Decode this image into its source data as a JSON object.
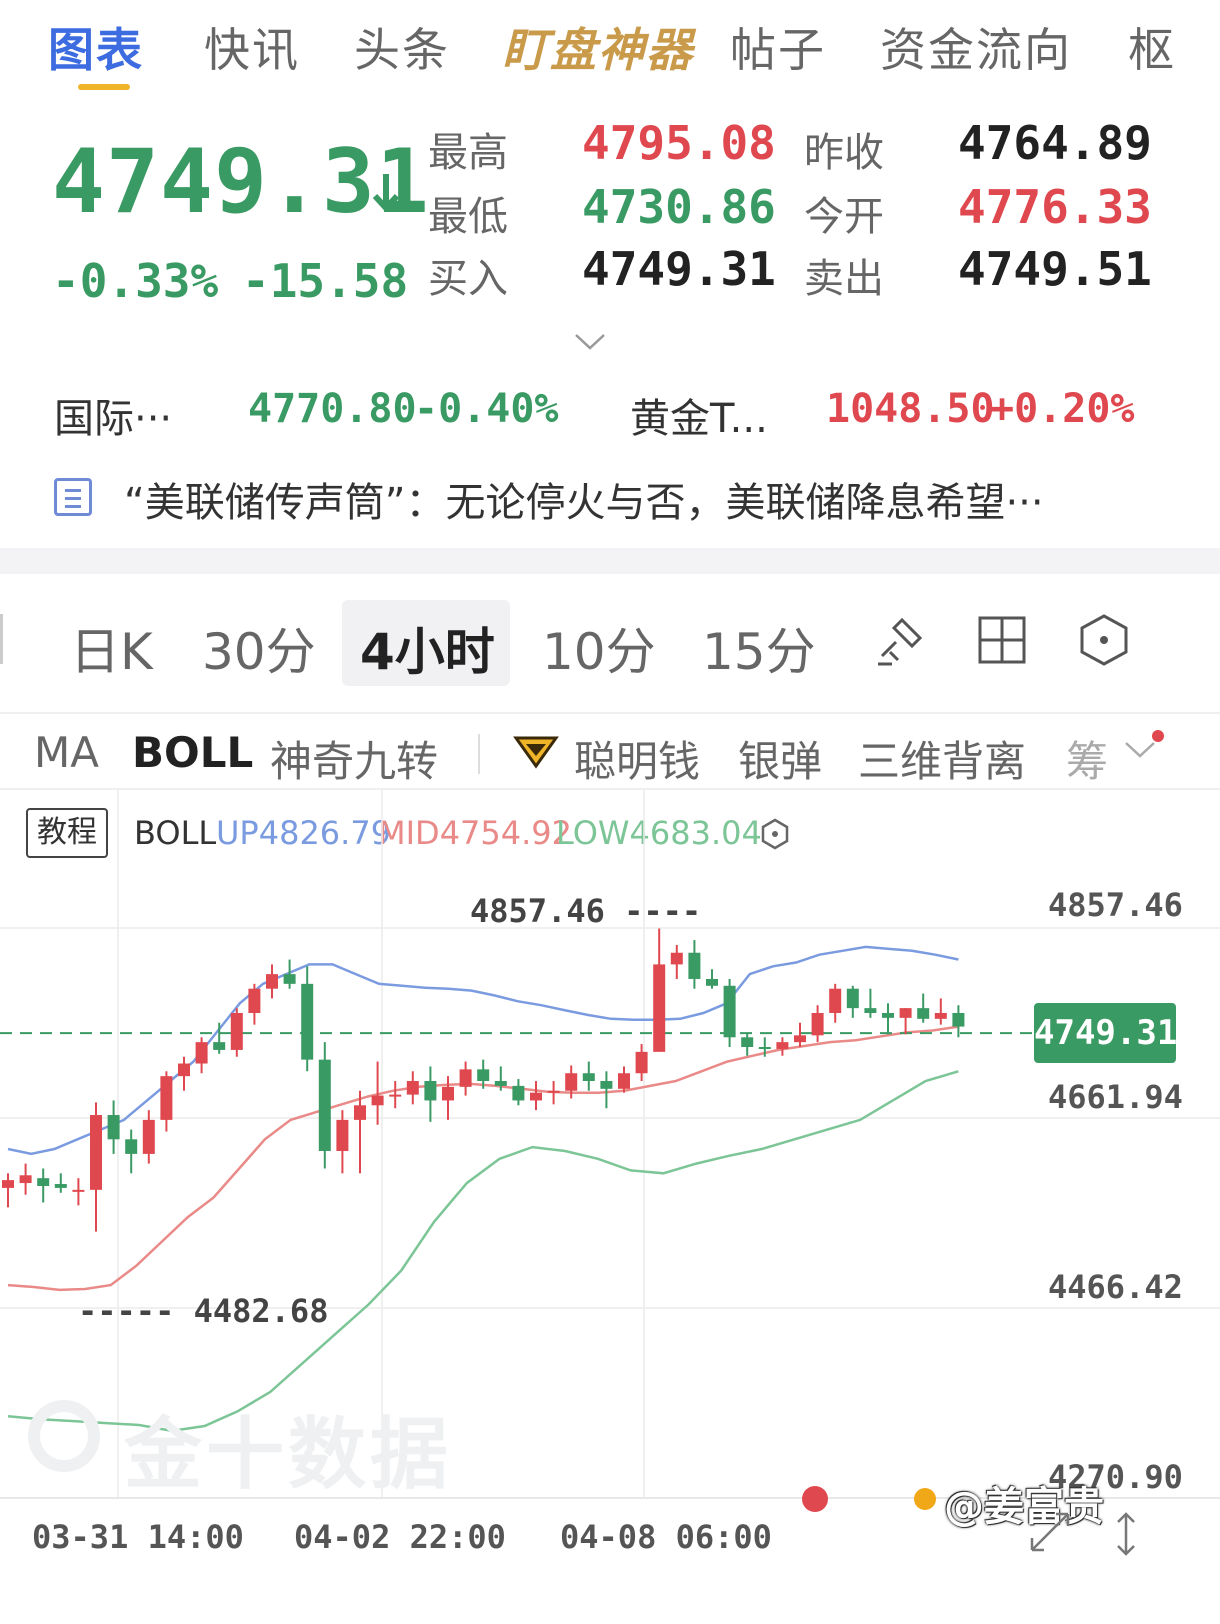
{
  "top_tabs": {
    "chart": "图表",
    "news": "快讯",
    "headlines": "头条",
    "watch_tool": "盯盘神器",
    "posts": "帖子",
    "fund_flow": "资金流向",
    "more": "枢"
  },
  "quote": {
    "price": "4749.31",
    "direction_icon": "down-arrow-icon",
    "change_pct": "-0.33%",
    "change_abs": "-15.58",
    "high_label": "最高",
    "high": "4795.08",
    "low_label": "最低",
    "low": "4730.86",
    "bid_label": "买入",
    "bid": "4749.31",
    "prev_close_label": "昨收",
    "prev_close": "4764.89",
    "open_label": "今开",
    "open": "4776.33",
    "ask_label": "卖出",
    "ask": "4749.51",
    "expand_icon": "chevron-down-icon"
  },
  "refs": [
    {
      "name": "国际···",
      "price": "4770.80",
      "change": "-0.40%"
    },
    {
      "name": "黄金T...",
      "price": "1048.50",
      "change": "+0.20%"
    }
  ],
  "news": {
    "text": "“美联储传声筒”：无论停火与否，美联储降息希望···"
  },
  "period_tabs": [
    "日K",
    "30分",
    "4小时",
    "10分",
    "15分"
  ],
  "period_active": "4小时",
  "tools": [
    "draw-pen-icon",
    "grid-layout-icon",
    "settings-hexagon-icon"
  ],
  "indicator_tabs": {
    "ma": "MA",
    "boll": "BOLL",
    "magic9": "神奇九转",
    "smart_money": "聪明钱",
    "silver_bullet": "银弹",
    "three_d": "三维背离",
    "chips": "筹"
  },
  "chart": {
    "tutorial": "教程",
    "boll_label": "BOLL",
    "up": "UP4826.79",
    "mid": "MID4754.92",
    "low": "LOW4683.04",
    "y_ticks": [
      "4857.46",
      "4661.94",
      "4466.42",
      "4270.90"
    ],
    "current_price": "4749.31",
    "max_annot": "4857.46 ----",
    "min_annot": "----- 4482.68",
    "x_ticks": [
      "03-31 14:00",
      "04-02 22:00",
      "04-08 06:00"
    ],
    "watermark": "金十数据",
    "credit": "@姜富贵",
    "colors": {
      "up": "#e0484f",
      "down": "#3a9a63",
      "boll_up": "#7b9be0",
      "boll_mid": "#e98a88",
      "boll_low": "#7cc596"
    }
  },
  "chart_data": {
    "type": "candlestick",
    "ylim": [
      4270.9,
      4857.46
    ],
    "max_marker": 4857.46,
    "min_marker": 4482.68,
    "last_price": 4749.31,
    "candles": [
      {
        "o": 4590,
        "h": 4605,
        "l": 4570,
        "c": 4598
      },
      {
        "o": 4595,
        "h": 4615,
        "l": 4583,
        "c": 4603
      },
      {
        "o": 4600,
        "h": 4610,
        "l": 4575,
        "c": 4592
      },
      {
        "o": 4594,
        "h": 4605,
        "l": 4585,
        "c": 4590
      },
      {
        "o": 4588,
        "h": 4600,
        "l": 4572,
        "c": 4588
      },
      {
        "o": 4588,
        "h": 4678,
        "l": 4545,
        "c": 4665
      },
      {
        "o": 4665,
        "h": 4680,
        "l": 4625,
        "c": 4640
      },
      {
        "o": 4640,
        "h": 4650,
        "l": 4605,
        "c": 4625
      },
      {
        "o": 4625,
        "h": 4670,
        "l": 4615,
        "c": 4660
      },
      {
        "o": 4660,
        "h": 4710,
        "l": 4648,
        "c": 4705
      },
      {
        "o": 4705,
        "h": 4725,
        "l": 4690,
        "c": 4718
      },
      {
        "o": 4718,
        "h": 4745,
        "l": 4708,
        "c": 4740
      },
      {
        "o": 4740,
        "h": 4760,
        "l": 4728,
        "c": 4732
      },
      {
        "o": 4732,
        "h": 4775,
        "l": 4725,
        "c": 4770
      },
      {
        "o": 4770,
        "h": 4800,
        "l": 4758,
        "c": 4795
      },
      {
        "o": 4795,
        "h": 4820,
        "l": 4785,
        "c": 4810
      },
      {
        "o": 4810,
        "h": 4825,
        "l": 4795,
        "c": 4800
      },
      {
        "o": 4800,
        "h": 4818,
        "l": 4710,
        "c": 4722
      },
      {
        "o": 4722,
        "h": 4740,
        "l": 4610,
        "c": 4628
      },
      {
        "o": 4628,
        "h": 4670,
        "l": 4605,
        "c": 4660
      },
      {
        "o": 4660,
        "h": 4690,
        "l": 4605,
        "c": 4675
      },
      {
        "o": 4675,
        "h": 4720,
        "l": 4655,
        "c": 4685
      },
      {
        "o": 4685,
        "h": 4700,
        "l": 4672,
        "c": 4686
      },
      {
        "o": 4686,
        "h": 4710,
        "l": 4676,
        "c": 4700
      },
      {
        "o": 4700,
        "h": 4715,
        "l": 4658,
        "c": 4680
      },
      {
        "o": 4680,
        "h": 4705,
        "l": 4660,
        "c": 4694
      },
      {
        "o": 4694,
        "h": 4720,
        "l": 4685,
        "c": 4712
      },
      {
        "o": 4712,
        "h": 4722,
        "l": 4692,
        "c": 4700
      },
      {
        "o": 4700,
        "h": 4715,
        "l": 4690,
        "c": 4695
      },
      {
        "o": 4695,
        "h": 4702,
        "l": 4675,
        "c": 4680
      },
      {
        "o": 4680,
        "h": 4700,
        "l": 4670,
        "c": 4688
      },
      {
        "o": 4688,
        "h": 4700,
        "l": 4676,
        "c": 4690
      },
      {
        "o": 4690,
        "h": 4716,
        "l": 4682,
        "c": 4708
      },
      {
        "o": 4708,
        "h": 4720,
        "l": 4690,
        "c": 4700
      },
      {
        "o": 4700,
        "h": 4710,
        "l": 4672,
        "c": 4692
      },
      {
        "o": 4692,
        "h": 4715,
        "l": 4688,
        "c": 4708
      },
      {
        "o": 4708,
        "h": 4738,
        "l": 4700,
        "c": 4730
      },
      {
        "o": 4730,
        "h": 4857,
        "l": 4743,
        "c": 4820
      },
      {
        "o": 4820,
        "h": 4840,
        "l": 4805,
        "c": 4832
      },
      {
        "o": 4832,
        "h": 4845,
        "l": 4795,
        "c": 4805
      },
      {
        "o": 4805,
        "h": 4815,
        "l": 4795,
        "c": 4798
      },
      {
        "o": 4798,
        "h": 4805,
        "l": 4735,
        "c": 4745
      },
      {
        "o": 4745,
        "h": 4750,
        "l": 4726,
        "c": 4735
      },
      {
        "o": 4735,
        "h": 4745,
        "l": 4725,
        "c": 4733
      },
      {
        "o": 4733,
        "h": 4745,
        "l": 4726,
        "c": 4740
      },
      {
        "o": 4740,
        "h": 4760,
        "l": 4735,
        "c": 4747
      },
      {
        "o": 4747,
        "h": 4778,
        "l": 4740,
        "c": 4770
      },
      {
        "o": 4770,
        "h": 4800,
        "l": 4760,
        "c": 4795
      },
      {
        "o": 4795,
        "h": 4798,
        "l": 4765,
        "c": 4775
      },
      {
        "o": 4775,
        "h": 4795,
        "l": 4765,
        "c": 4770
      },
      {
        "o": 4770,
        "h": 4780,
        "l": 4748,
        "c": 4765
      },
      {
        "o": 4765,
        "h": 4775,
        "l": 4748,
        "c": 4775
      },
      {
        "o": 4775,
        "h": 4790,
        "l": 4760,
        "c": 4764
      },
      {
        "o": 4764,
        "h": 4785,
        "l": 4758,
        "c": 4770
      },
      {
        "o": 4770,
        "h": 4778,
        "l": 4745,
        "c": 4756
      }
    ],
    "boll_up": [
      4630,
      4625,
      4630,
      4640,
      4650,
      4660,
      4680,
      4700,
      4720,
      4750,
      4780,
      4800,
      4810,
      4820,
      4820,
      4810,
      4800,
      4798,
      4796,
      4795,
      4793,
      4788,
      4782,
      4778,
      4773,
      4768,
      4764,
      4763,
      4763,
      4764,
      4770,
      4780,
      4810,
      4818,
      4822,
      4830,
      4834,
      4838,
      4836,
      4834,
      4830,
      4825
    ],
    "boll_mid": [
      4490,
      4488,
      4485,
      4486,
      4490,
      4510,
      4535,
      4560,
      4580,
      4610,
      4640,
      4660,
      4668,
      4676,
      4684,
      4690,
      4694,
      4696,
      4697,
      4695,
      4692,
      4689,
      4688,
      4688,
      4690,
      4695,
      4700,
      4710,
      4720,
      4726,
      4732,
      4736,
      4740,
      4742,
      4746,
      4750,
      4752,
      4756
    ],
    "boll_low": [
      4355,
      4352,
      4350,
      4348,
      4346,
      4340,
      4345,
      4360,
      4380,
      4410,
      4440,
      4470,
      4505,
      4555,
      4595,
      4620,
      4632,
      4628,
      4620,
      4608,
      4605,
      4615,
      4623,
      4630,
      4640,
      4650,
      4660,
      4680,
      4700,
      4710
    ],
    "x_ticks": [
      "03-31 14:00",
      "04-02 22:00",
      "04-08 06:00"
    ]
  }
}
